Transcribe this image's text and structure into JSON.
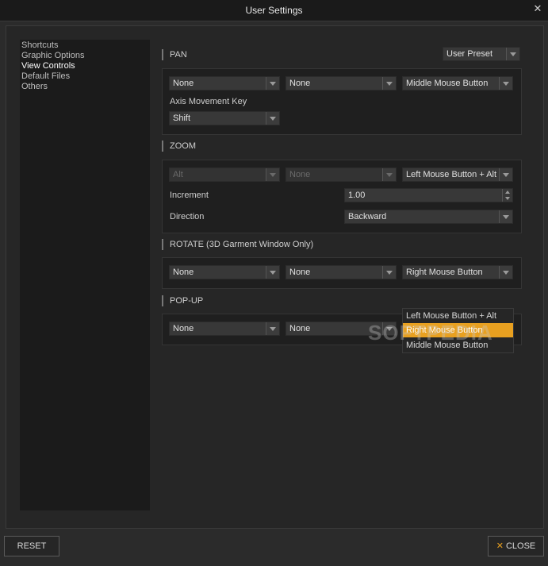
{
  "window": {
    "title": "User Settings",
    "close_glyph": "✕"
  },
  "sidebar": {
    "items": [
      {
        "label": "Shortcuts"
      },
      {
        "label": "Graphic Options"
      },
      {
        "label": "View Controls"
      },
      {
        "label": "Default Files"
      },
      {
        "label": "Others"
      }
    ],
    "active": "View Controls"
  },
  "preset": {
    "value": "User Preset"
  },
  "pan": {
    "title": "PAN",
    "dd1": "None",
    "dd2": "None",
    "dd3": "Middle Mouse Button",
    "axis_label": "Axis Movement Key",
    "axis_value": "Shift"
  },
  "zoom": {
    "title": "ZOOM",
    "dd1": "Alt",
    "dd2": "None",
    "dd3": "Left Mouse Button + Alt",
    "increment_label": "Increment",
    "increment_value": "1.00",
    "direction_label": "Direction",
    "direction_value": "Backward"
  },
  "rotate": {
    "title": "ROTATE (3D Garment Window Only)",
    "dd1": "None",
    "dd2": "None",
    "dd3": "Right Mouse Button"
  },
  "popup_section": {
    "title": "POP-UP",
    "dd1": "None",
    "dd2": "None"
  },
  "dropdown_menu": {
    "options": [
      "Left Mouse Button + Alt",
      "Right Mouse Button",
      "Middle Mouse Button"
    ],
    "highlighted": "Right Mouse Button"
  },
  "footer": {
    "reset": "RESET",
    "close": "CLOSE"
  },
  "watermark": "SOFTPEDIA",
  "colors": {
    "accent": "#e8a020",
    "background": "#2b2b2b",
    "panel": "#1f1f1f"
  }
}
